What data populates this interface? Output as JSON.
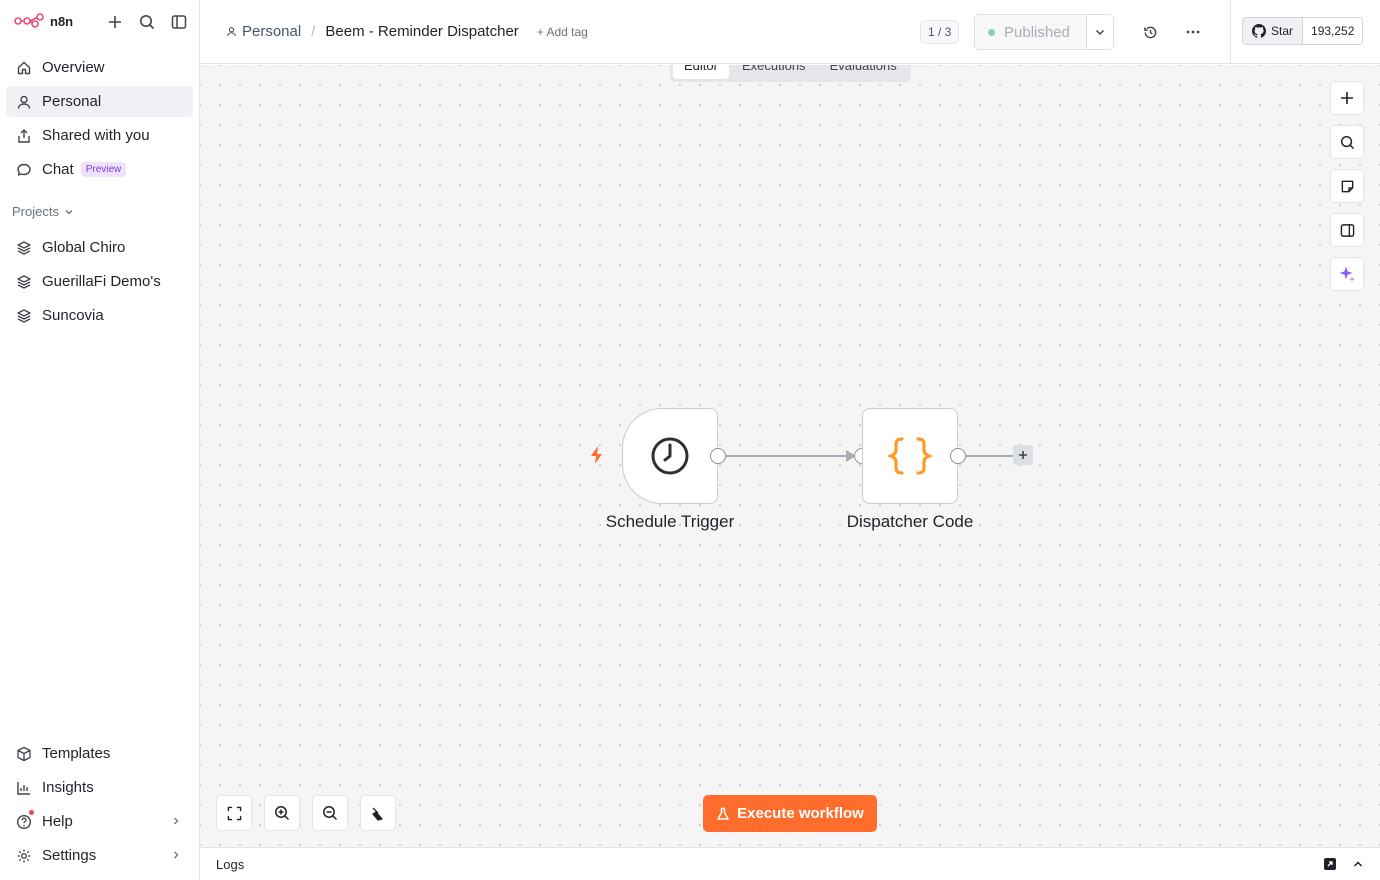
{
  "app": {
    "name": "n8n"
  },
  "sidebar": {
    "nav": [
      {
        "label": "Overview",
        "icon": "home-icon"
      },
      {
        "label": "Personal",
        "icon": "user-icon"
      },
      {
        "label": "Shared with you",
        "icon": "share-icon"
      },
      {
        "label": "Chat",
        "icon": "chat-icon",
        "badge": "Preview"
      }
    ],
    "projects_label": "Projects",
    "projects": [
      {
        "label": "Global Chiro",
        "icon": "layers-icon"
      },
      {
        "label": "GuerillaFi Demo's",
        "icon": "layers-icon"
      },
      {
        "label": "Suncovia",
        "icon": "layers-icon"
      }
    ],
    "bottom": [
      {
        "label": "Templates",
        "icon": "box-icon"
      },
      {
        "label": "Insights",
        "icon": "chart-icon"
      },
      {
        "label": "Help",
        "icon": "help-icon"
      },
      {
        "label": "Settings",
        "icon": "gear-icon"
      }
    ]
  },
  "header": {
    "breadcrumb_project": "Personal",
    "breadcrumb_separator": "/",
    "workflow_title": "Beem - Reminder Dispatcher",
    "add_tag": "+ Add tag",
    "version": "1 / 3",
    "publish_label": "Published",
    "github_star": "Star",
    "github_count": "193,252"
  },
  "tabs": [
    {
      "label": "Editor",
      "active": true
    },
    {
      "label": "Executions",
      "active": false
    },
    {
      "label": "Evaluations",
      "active": false
    }
  ],
  "nodes": [
    {
      "label": "Schedule Trigger",
      "icon": "clock-icon"
    },
    {
      "label": "Dispatcher Code",
      "icon": "code-braces-icon"
    }
  ],
  "execute_button": "Execute workflow",
  "logs": {
    "label": "Logs"
  },
  "colors": {
    "accent": "#ff6d2d",
    "preview_badge": "#7d3bd9",
    "published_dot": "#8fc9c3",
    "ai_sparkle": "#8b5cf6"
  }
}
